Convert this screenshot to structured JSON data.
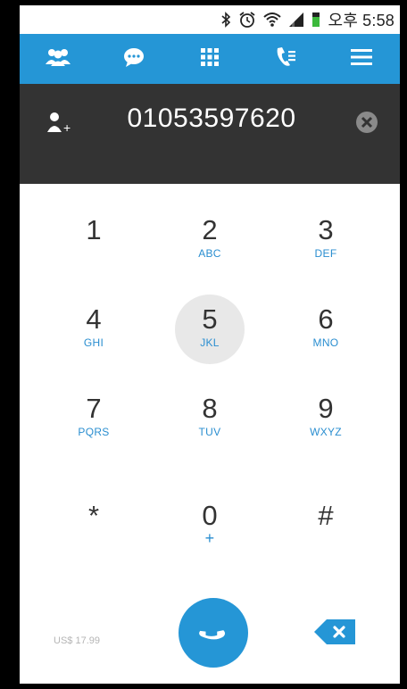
{
  "status_bar": {
    "time": "오후 5:58",
    "icons": [
      "bluetooth-icon",
      "alarm-icon",
      "wifi-icon",
      "signal-icon",
      "battery-icon"
    ]
  },
  "toolbar": {
    "items": [
      {
        "name": "contacts",
        "icon": "contacts-icon"
      },
      {
        "name": "messages",
        "icon": "chat-icon"
      },
      {
        "name": "dialpad",
        "icon": "dialpad-icon"
      },
      {
        "name": "call-log",
        "icon": "call-log-icon"
      },
      {
        "name": "menu",
        "icon": "menu-icon"
      }
    ],
    "color": "#2596d6"
  },
  "display": {
    "number": "01053597620",
    "add_contact_label": "+"
  },
  "keypad": {
    "keys": [
      {
        "digit": "1",
        "letters": ""
      },
      {
        "digit": "2",
        "letters": "ABC"
      },
      {
        "digit": "3",
        "letters": "DEF"
      },
      {
        "digit": "4",
        "letters": "GHI"
      },
      {
        "digit": "5",
        "letters": "JKL"
      },
      {
        "digit": "6",
        "letters": "MNO"
      },
      {
        "digit": "7",
        "letters": "PQRS"
      },
      {
        "digit": "8",
        "letters": "TUV"
      },
      {
        "digit": "9",
        "letters": "WXYZ"
      },
      {
        "digit": "*",
        "letters": ""
      },
      {
        "digit": "0",
        "letters": "+"
      },
      {
        "digit": "#",
        "letters": ""
      }
    ],
    "pressed_key": "5"
  },
  "bottom": {
    "price": "US$ 17.99"
  }
}
